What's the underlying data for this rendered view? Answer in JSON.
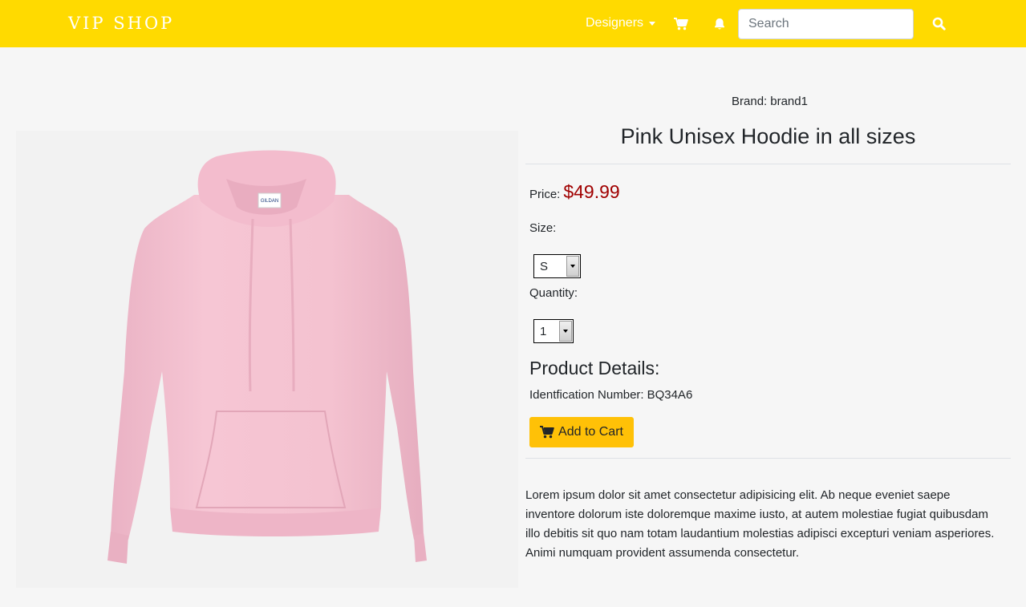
{
  "navbar": {
    "brand": "VIP SHOP",
    "designers_label": "Designers",
    "search_placeholder": "Search",
    "icons": [
      "shopping-cart-icon",
      "bell-icon",
      "search-icon"
    ],
    "background_color": "#ffda00"
  },
  "product": {
    "brand_label": "Brand:",
    "brand_value": "brand1",
    "title": "Pink Unisex Hoodie in all sizes",
    "price_label": "Price:",
    "price_value": "$49.99",
    "price_color": "#a00000",
    "size_label": "Size:",
    "size_selected": "S",
    "quantity_label": "Quantity:",
    "quantity_selected": "1",
    "details_heading": "Product Details:",
    "identification_label": "Identfication Number:",
    "identification_value": "BQ34A6",
    "add_to_cart_label": "Add to Cart",
    "button_color": "#ffc107",
    "description": "Lorem ipsum dolor sit amet consectetur adipisicing elit. Ab neque eveniet saepe inventore dolorum iste doloremque maxime iusto, at autem molestiae fugiat quibusdam illo debitis sit quo nam totam laudantium molestias adipisci excepturi veniam asperiores. Animi numquam provident assumenda consectetur.",
    "image_label_text": "GILDAN"
  }
}
